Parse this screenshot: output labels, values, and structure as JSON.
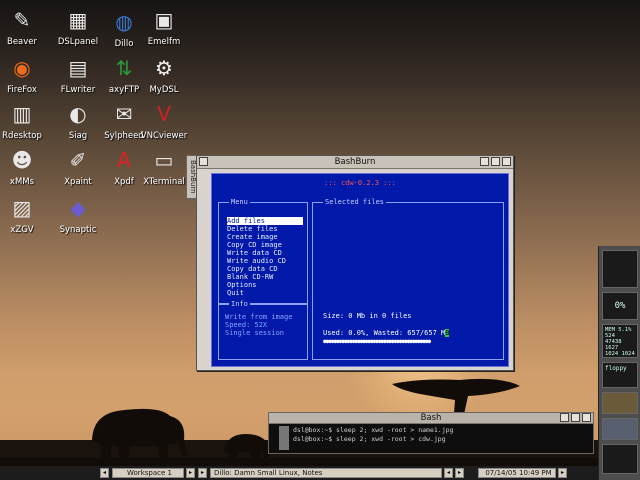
{
  "desktop_icons": [
    {
      "label": "Beaver",
      "icon": "beaver-pen-icon"
    },
    {
      "label": "DSLpanel",
      "icon": "dslpanel-icon"
    },
    {
      "label": "Dillo",
      "icon": "dillo-globe-icon"
    },
    {
      "label": "Emelfm",
      "icon": "emelfm-icon"
    },
    {
      "label": "FireFox",
      "icon": "firefox-icon"
    },
    {
      "label": "FLwriter",
      "icon": "flwriter-icon"
    },
    {
      "label": "axyFTP",
      "icon": "axyftp-icon"
    },
    {
      "label": "MyDSL",
      "icon": "mydsl-gears-icon"
    },
    {
      "label": "Rdesktop",
      "icon": "rdesktop-icon"
    },
    {
      "label": "Siag",
      "icon": "siag-icon"
    },
    {
      "label": "Sylpheed",
      "icon": "sylpheed-icon"
    },
    {
      "label": "VNCviewer",
      "icon": "vnc-icon"
    },
    {
      "label": "xMMs",
      "icon": "xmms-penguin-icon"
    },
    {
      "label": "Xpaint",
      "icon": "xpaint-icon"
    },
    {
      "label": "Xpdf",
      "icon": "xpdf-icon"
    },
    {
      "label": "XTerminal",
      "icon": "xterminal-icon"
    },
    {
      "label": "xZGV",
      "icon": "xzgv-icon"
    },
    {
      "label": "Synaptic",
      "icon": "synaptic-icon"
    }
  ],
  "bashburn": {
    "title": "BashBurn",
    "side_tab": "BashBurn",
    "header": "::: cdw-0.2.3 :::",
    "menu_label": "Menu",
    "menu_items": [
      "Add files",
      "Delete files",
      "Create image",
      "Copy CD image",
      "Write data CD",
      "Write audio CD",
      "Copy data CD",
      "Blank CD-RW",
      "Options",
      "Quit"
    ],
    "selected_index": 0,
    "info_label": "Info",
    "info_lines": [
      "Write from image",
      "Speed: 52X",
      "Single session"
    ],
    "selected_label": "Selected files",
    "size_text": "Size: 0 Mb in 0 files",
    "used_text": "Used: 0.0%, Wasted: 657/657 M",
    "used_highlight": "B",
    "dots": "●●●●●●●●●●●●●●●●●●●●●●●●●●●●●●●●●●●●●●●●●"
  },
  "bash": {
    "title": "Bash",
    "lines": [
      "dsl@box:~$ sleep 2; xwd -root > name1.jpg",
      "dsl@box:~$ sleep 2; xwd -root > cdw.jpg"
    ]
  },
  "taskbar": {
    "workspace": "Workspace 1",
    "task": "Dillo: Damn Small Linux, Notes",
    "clock": "07/14/05 10:49 PM"
  },
  "dock": {
    "cpu": "0%",
    "stats": [
      "MEM 5.1% 524",
      "47438 1627",
      "1024 1024"
    ],
    "floppy": "floppy"
  },
  "colors": {
    "terminal_bg": "#0019a8",
    "accent_red": "#ff5050",
    "used_green": "#20d040"
  }
}
